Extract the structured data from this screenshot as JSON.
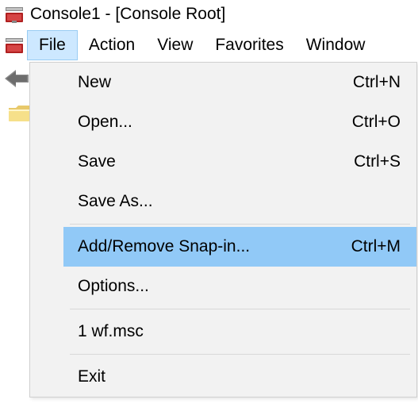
{
  "window": {
    "title": "Console1 - [Console Root]"
  },
  "menubar": {
    "file": "File",
    "action": "Action",
    "view": "View",
    "favorites": "Favorites",
    "window": "Window"
  },
  "file_menu": {
    "new_label": "New",
    "new_shortcut": "Ctrl+N",
    "open_label": "Open...",
    "open_shortcut": "Ctrl+O",
    "save_label": "Save",
    "save_shortcut": "Ctrl+S",
    "saveas_label": "Save As...",
    "snapin_label": "Add/Remove Snap-in...",
    "snapin_shortcut": "Ctrl+M",
    "options_label": "Options...",
    "recent1_label": "1 wf.msc",
    "exit_label": "Exit"
  }
}
